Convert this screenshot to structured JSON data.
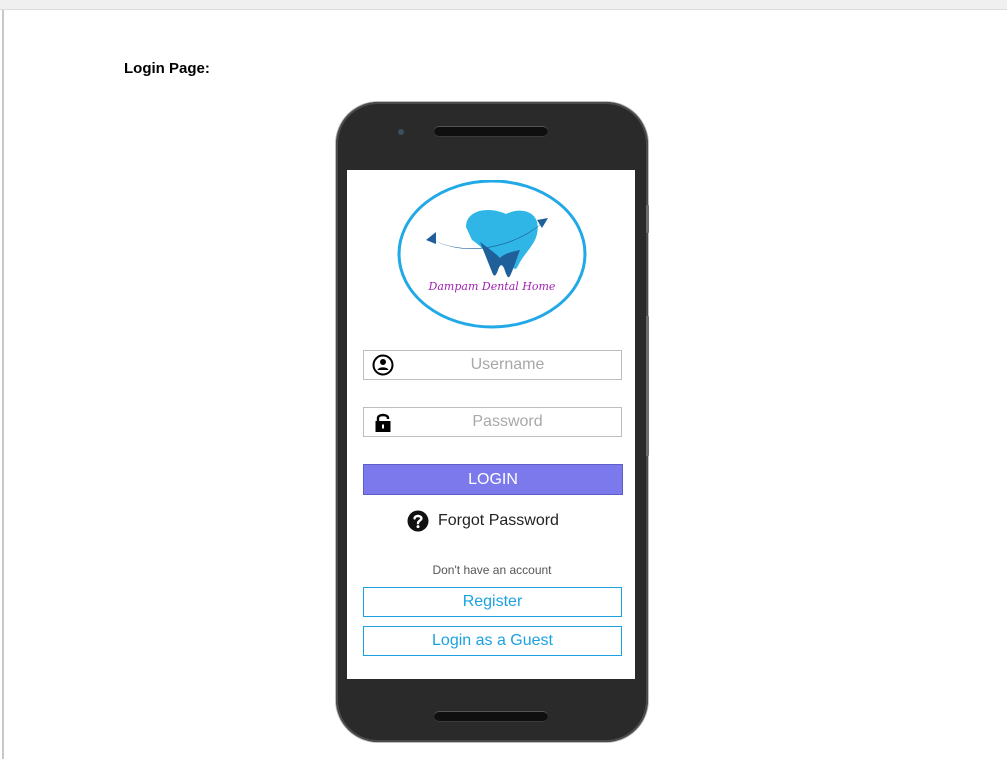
{
  "document": {
    "heading": "Login Page:"
  },
  "logo": {
    "caption": "Dampam Dental Home"
  },
  "form": {
    "username_placeholder": "Username",
    "password_placeholder": "Password",
    "login_label": "LOGIN",
    "forgot_label": "Forgot Password",
    "no_account_text": "Don't have an account",
    "register_label": "Register",
    "guest_label": "Login as a Guest"
  },
  "icons": {
    "user": "user-circle-icon",
    "lock": "lock-icon",
    "help": "question-circle-icon"
  },
  "colors": {
    "login_button": "#7b79ec",
    "accent_blue": "#1ba1e2",
    "logo_dark": "#1f5f9a",
    "logo_light": "#2fb6e6",
    "logo_text": "#a21fb4",
    "phone_body": "#2a2a2a"
  }
}
